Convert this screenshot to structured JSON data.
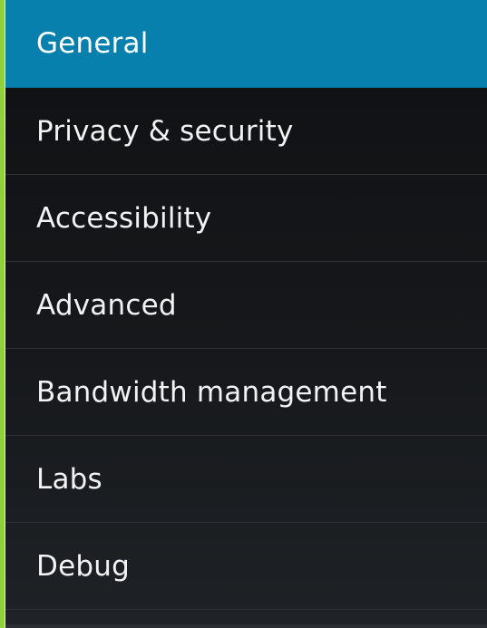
{
  "settings_menu": {
    "selected_index": 0,
    "items": [
      {
        "label": "General"
      },
      {
        "label": "Privacy & security"
      },
      {
        "label": "Accessibility"
      },
      {
        "label": "Advanced"
      },
      {
        "label": "Bandwidth management"
      },
      {
        "label": "Labs"
      },
      {
        "label": "Debug"
      }
    ]
  },
  "colors": {
    "selected_background": "#0880ad",
    "panel_background": "#16181b",
    "left_edge_accent": "#8fd13a",
    "divider": "#2d3134",
    "text": "#f2f2f2"
  }
}
